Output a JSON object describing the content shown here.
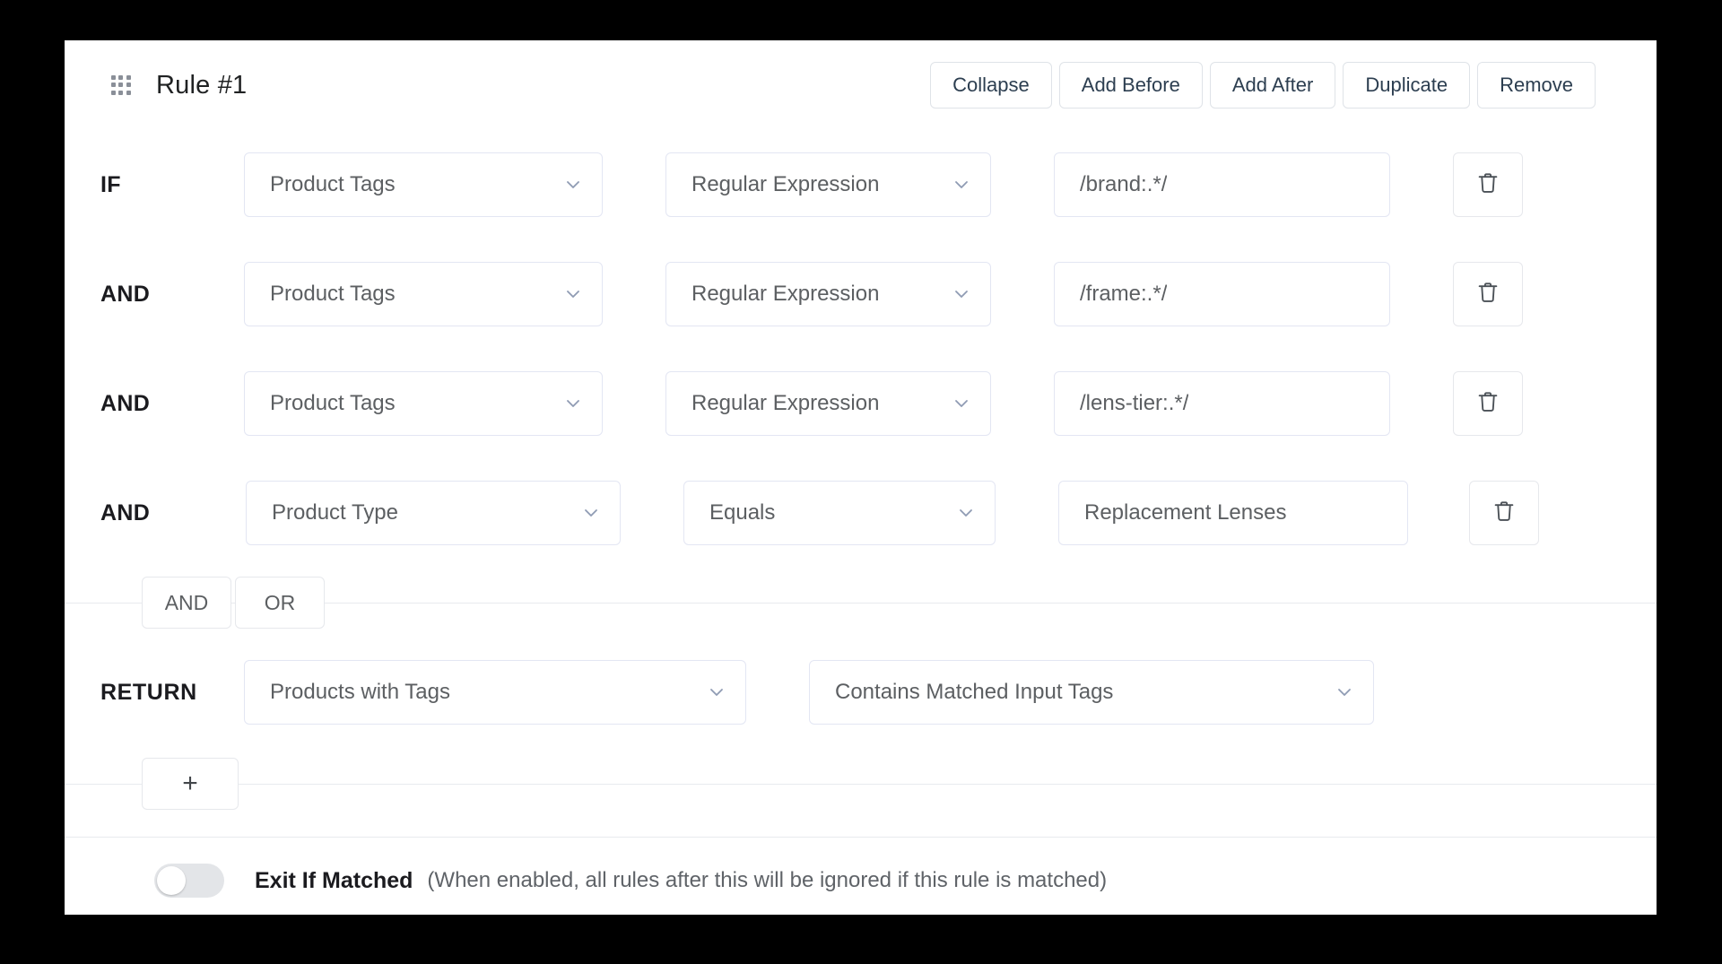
{
  "header": {
    "drag_handle_icon": "drag-dots-icon",
    "title": "Rule #1",
    "actions": [
      {
        "label": "Collapse"
      },
      {
        "label": "Add Before"
      },
      {
        "label": "Add After"
      },
      {
        "label": "Duplicate"
      },
      {
        "label": "Remove"
      }
    ]
  },
  "conditions": [
    {
      "conjunction": "IF",
      "field": "Product Tags",
      "operator": "Regular Expression",
      "value": "/brand:.*/",
      "delete_icon": "trash-icon"
    },
    {
      "conjunction": "AND",
      "field": "Product Tags",
      "operator": "Regular Expression",
      "value": "/frame:.*/",
      "delete_icon": "trash-icon"
    },
    {
      "conjunction": "AND",
      "field": "Product Tags",
      "operator": "Regular Expression",
      "value": "/lens-tier:.*/",
      "delete_icon": "trash-icon"
    },
    {
      "conjunction": "AND",
      "field": "Product Type",
      "operator": "Equals",
      "value": "Replacement Lenses",
      "delete_icon": "trash-icon"
    }
  ],
  "conjunction_toggle": {
    "options": [
      {
        "label": "AND"
      },
      {
        "label": "OR"
      }
    ]
  },
  "return_row": {
    "label": "RETURN",
    "target": "Products with Tags",
    "mode": "Contains Matched Input Tags"
  },
  "add_condition": {
    "label": "+",
    "icon": "plus-icon"
  },
  "footer": {
    "toggle_state": "off",
    "label": "Exit If Matched",
    "hint": "(When enabled, all rules after this will be ignored if this rule is matched)"
  },
  "colors": {
    "page_background": "#000000",
    "card_background": "#ffffff",
    "field_border": "#e3e6f3",
    "button_border": "#dfe3e8",
    "divider": "#e8eaee",
    "text_primary": "#1b1b1f",
    "text_secondary": "#5c5f62",
    "switch_track_off": "#e3e5e8"
  }
}
